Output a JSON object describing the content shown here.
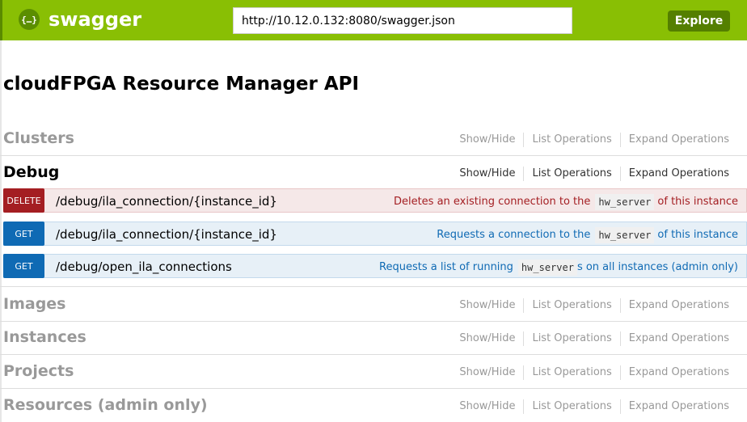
{
  "header": {
    "logo_glyph": "{…}",
    "logo_text": "swagger",
    "url_value": "http://10.12.0.132:8080/swagger.json",
    "explore_label": "Explore",
    "accent": "#89bf04"
  },
  "page_title": "cloudFPGA Resource Manager API",
  "ops_labels": {
    "show_hide": "Show/Hide",
    "list": "List Operations",
    "expand": "Expand Operations"
  },
  "resources": [
    {
      "name": "Clusters",
      "expanded": false
    },
    {
      "name": "Debug",
      "expanded": true
    },
    {
      "name": "Images",
      "expanded": false
    },
    {
      "name": "Instances",
      "expanded": false
    },
    {
      "name": "Projects",
      "expanded": false
    },
    {
      "name": "Resources (admin only)",
      "expanded": false
    }
  ],
  "debug_operations": [
    {
      "method": "DELETE",
      "path": "/debug/ila_connection/{instance_id}",
      "summary_pre": "Deletes an existing connection to the",
      "summary_code": "hw_server",
      "summary_post": "of this instance"
    },
    {
      "method": "GET",
      "path": "/debug/ila_connection/{instance_id}",
      "summary_pre": "Requests a connection to the",
      "summary_code": "hw_server",
      "summary_post": "of this instance"
    },
    {
      "method": "GET",
      "path": "/debug/open_ila_connections",
      "summary_pre": "Requests a list of running",
      "summary_code": "hw_server",
      "summary_post": "s on all instances (admin only)"
    }
  ]
}
